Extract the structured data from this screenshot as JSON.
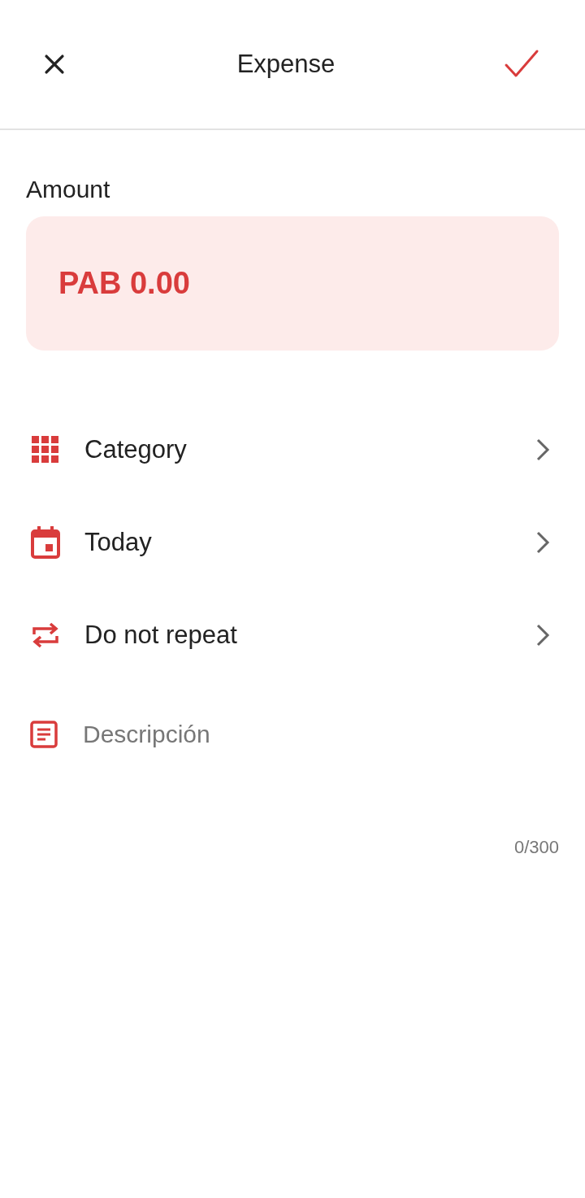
{
  "header": {
    "title": "Expense"
  },
  "amount": {
    "label": "Amount",
    "value": "PAB 0.00"
  },
  "options": [
    {
      "kind": "category",
      "label": "Category"
    },
    {
      "kind": "date",
      "label": "Today"
    },
    {
      "kind": "repeat",
      "label": "Do not repeat"
    }
  ],
  "description": {
    "placeholder": "Descripción",
    "counter": "0/300"
  }
}
